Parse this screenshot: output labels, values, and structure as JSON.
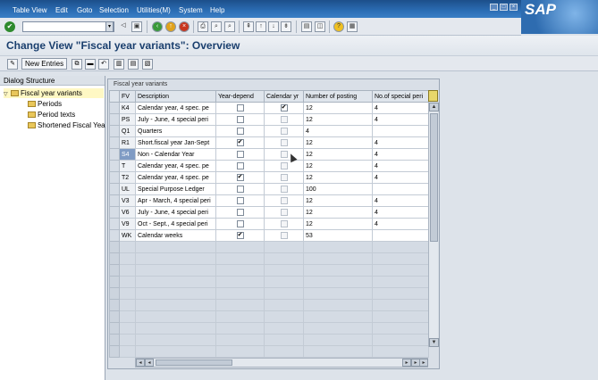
{
  "menubar": {
    "items": [
      "Table View",
      "Edit",
      "Goto",
      "Selection",
      "Utilities(M)",
      "System",
      "Help"
    ],
    "logo": "SAP"
  },
  "title": "Change View \"Fiscal year variants\": Overview",
  "app_toolbar": {
    "new_entries": "New Entries"
  },
  "dialog_structure": {
    "header": "Dialog Structure",
    "items": [
      {
        "label": "Fiscal year variants",
        "level": 0,
        "selected": true
      },
      {
        "label": "Periods",
        "level": 1
      },
      {
        "label": "Period texts",
        "level": 1
      },
      {
        "label": "Shortened Fiscal Yea",
        "level": 1
      }
    ]
  },
  "table": {
    "caption": "Fiscal year variants",
    "columns": [
      "FV",
      "Description",
      "Year-depend",
      "Calendar yr",
      "Number of posting",
      "No.of special peri"
    ],
    "rows": [
      {
        "fv": "K4",
        "description": "Calendar year, 4 spec. pe",
        "year_dep": false,
        "cal_yr": true,
        "posting": "12",
        "special": "4"
      },
      {
        "fv": "PS",
        "description": "July - June, 4 special peri",
        "year_dep": false,
        "cal_yr": false,
        "posting": "12",
        "special": "4"
      },
      {
        "fv": "Q1",
        "description": "Quarters",
        "year_dep": false,
        "cal_yr": false,
        "posting": "4",
        "special": ""
      },
      {
        "fv": "R1",
        "description": "Short.fiscal year Jan-Sept",
        "year_dep": true,
        "cal_yr": false,
        "posting": "12",
        "special": "4"
      },
      {
        "fv": "S4",
        "description": "Non - Calendar Year",
        "year_dep": false,
        "cal_yr": false,
        "posting": "12",
        "special": "4"
      },
      {
        "fv": "T",
        "description": "Calendar year, 4 spec. pe",
        "year_dep": false,
        "cal_yr": false,
        "posting": "12",
        "special": "4"
      },
      {
        "fv": "T2",
        "description": "Calendar year, 4 spec. pe",
        "year_dep": true,
        "cal_yr": false,
        "posting": "12",
        "special": "4"
      },
      {
        "fv": "UL",
        "description": "Special Purpose Ledger",
        "year_dep": false,
        "cal_yr": false,
        "posting": "100",
        "special": ""
      },
      {
        "fv": "V3",
        "description": "Apr - March, 4 special peri",
        "year_dep": false,
        "cal_yr": false,
        "posting": "12",
        "special": "4"
      },
      {
        "fv": "V6",
        "description": "July - June, 4 special peri",
        "year_dep": false,
        "cal_yr": false,
        "posting": "12",
        "special": "4"
      },
      {
        "fv": "V9",
        "description": "Oct - Sept., 4 special peri",
        "year_dep": false,
        "cal_yr": false,
        "posting": "12",
        "special": "4"
      },
      {
        "fv": "WK",
        "description": "Calendar weeks",
        "year_dep": true,
        "cal_yr": false,
        "posting": "53",
        "special": ""
      }
    ],
    "empty_rows": 10
  }
}
